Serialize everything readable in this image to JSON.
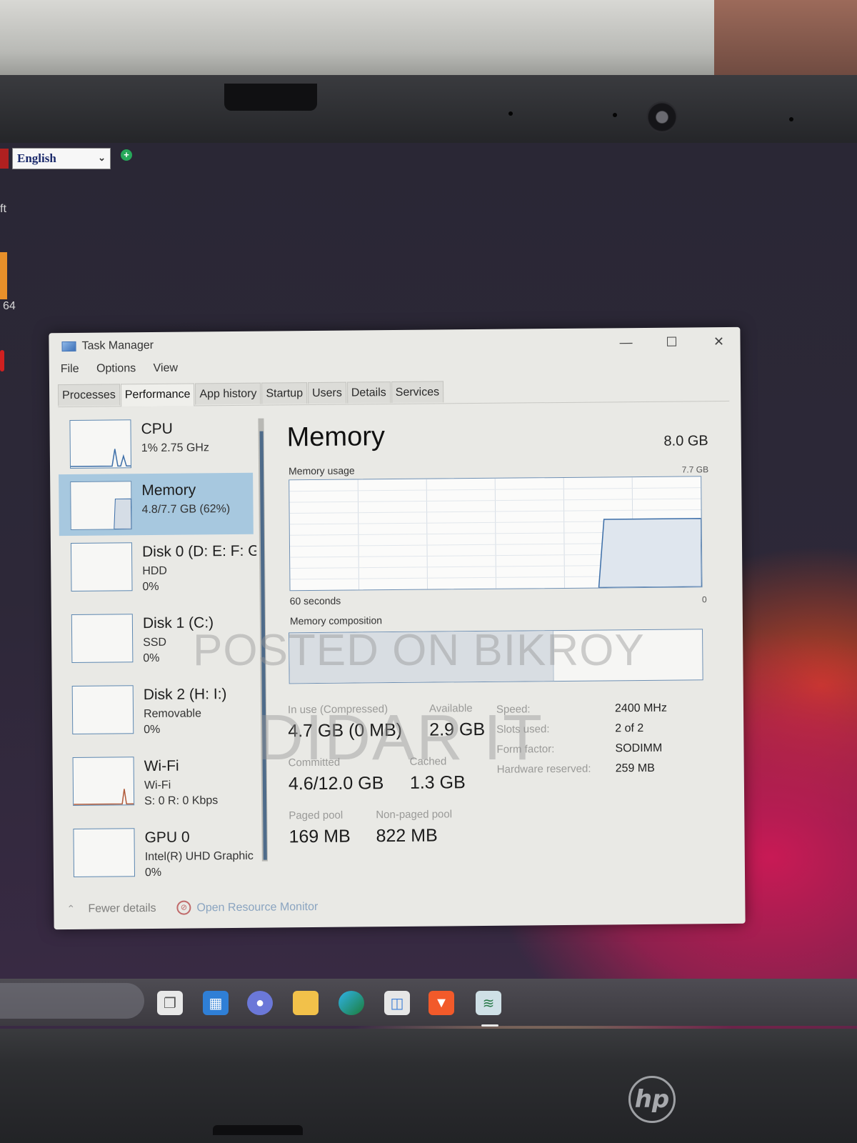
{
  "desktop": {
    "language_select": "English",
    "partial_label_1": "ft",
    "partial_label_2": "64"
  },
  "window": {
    "title": "Task Manager",
    "menu": [
      "File",
      "Options",
      "View"
    ],
    "tabs": [
      {
        "label": "Processes",
        "active": false
      },
      {
        "label": "Performance",
        "active": true
      },
      {
        "label": "App history",
        "active": false
      },
      {
        "label": "Startup",
        "active": false
      },
      {
        "label": "Users",
        "active": false
      },
      {
        "label": "Details",
        "active": false
      },
      {
        "label": "Services",
        "active": false
      }
    ]
  },
  "sidebar": {
    "items": [
      {
        "name": "CPU",
        "line1": "1%  2.75 GHz",
        "line2": "",
        "selected": false
      },
      {
        "name": "Memory",
        "line1": "4.8/7.7 GB (62%)",
        "line2": "",
        "selected": true
      },
      {
        "name": "Disk 0 (D: E: F: G",
        "line1": "HDD",
        "line2": "0%",
        "selected": false
      },
      {
        "name": "Disk 1 (C:)",
        "line1": "SSD",
        "line2": "0%",
        "selected": false
      },
      {
        "name": "Disk 2 (H: I:)",
        "line1": "Removable",
        "line2": "0%",
        "selected": false
      },
      {
        "name": "Wi-Fi",
        "line1": "Wi-Fi",
        "line2": "S: 0 R: 0 Kbps",
        "selected": false
      },
      {
        "name": "GPU 0",
        "line1": "Intel(R) UHD Graphic",
        "line2": "0%",
        "selected": false
      }
    ]
  },
  "memory": {
    "heading": "Memory",
    "total": "8.0 GB",
    "usage_label": "Memory usage",
    "usage_max": "7.7 GB",
    "time_left": "60 seconds",
    "time_right": "0",
    "composition_label": "Memory composition",
    "usage_fraction": 0.62,
    "stats": {
      "in_use_label": "In use (Compressed)",
      "in_use_value": "4.7 GB (0 MB)",
      "available_label": "Available",
      "available_value": "2.9 GB",
      "committed_label": "Committed",
      "committed_value": "4.6/12.0 GB",
      "cached_label": "Cached",
      "cached_value": "1.3 GB",
      "paged_label": "Paged pool",
      "paged_value": "169 MB",
      "nonpaged_label": "Non-paged pool",
      "nonpaged_value": "822 MB"
    },
    "specs": {
      "speed_label": "Speed:",
      "speed_value": "2400 MHz",
      "slots_label": "Slots used:",
      "slots_value": "2 of 2",
      "form_label": "Form factor:",
      "form_value": "SODIMM",
      "hw_label": "Hardware reserved:",
      "hw_value": "259 MB"
    }
  },
  "footer": {
    "fewer_details": "Fewer details",
    "open_resource_monitor": "Open Resource Monitor"
  },
  "watermark": {
    "line1": "POSTED ON BIKROY",
    "line2": "DIDAR IT"
  },
  "taskbar": {
    "icons": [
      "task-view-icon",
      "widgets-icon",
      "chat-icon",
      "file-explorer-icon",
      "edge-icon",
      "store-icon",
      "brave-icon",
      "task-manager-icon"
    ]
  },
  "laptop": {
    "logo": "hp"
  },
  "colors": {
    "selected_item": "#a7c8df",
    "graph_border": "#6e8fb3",
    "window_bg": "#e9e9e5"
  }
}
